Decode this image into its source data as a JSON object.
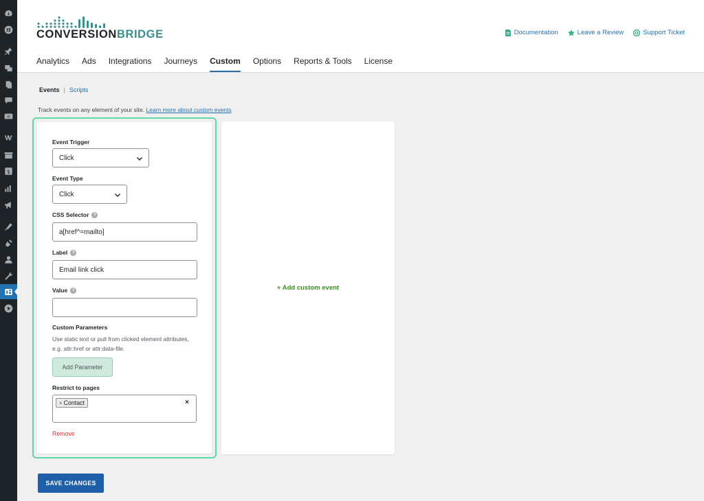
{
  "brand": {
    "logo_text_main": "CONVERSION",
    "logo_text_accent": "BRIDGE",
    "accent_color": "#3a8f8c",
    "bar_color": "#3a8f8c"
  },
  "top_links": [
    {
      "label": "Documentation",
      "icon": "document-icon"
    },
    {
      "label": "Leave a Review",
      "icon": "star-icon"
    },
    {
      "label": "Support Ticket",
      "icon": "lifebuoy-icon"
    }
  ],
  "tabs": [
    {
      "label": "Analytics",
      "active": false
    },
    {
      "label": "Ads",
      "active": false
    },
    {
      "label": "Integrations",
      "active": false
    },
    {
      "label": "Journeys",
      "active": false
    },
    {
      "label": "Custom",
      "active": true
    },
    {
      "label": "Options",
      "active": false
    },
    {
      "label": "Reports & Tools",
      "active": false
    },
    {
      "label": "License",
      "active": false
    }
  ],
  "subnav": {
    "active": "Events",
    "separator": "|",
    "link": "Scripts"
  },
  "intro": {
    "text": "Track events on any element of your site.",
    "link": "Learn more about custom events"
  },
  "event_form": {
    "event_trigger_label": "Event Trigger",
    "event_trigger_value": "Click",
    "event_type_label": "Event Type",
    "event_type_value": "Click",
    "css_selector_label": "CSS Selector",
    "css_selector_value": "a[href^=mailto]",
    "label_label": "Label",
    "label_value": "Email link click",
    "value_label": "Value",
    "value_value": "",
    "custom_params_label": "Custom Parameters",
    "custom_params_help": "Use static text or pull from clicked element attributes, e.g. attr:href or attr:data-file.",
    "add_parameter": "Add Parameter",
    "restrict_label": "Restrict to pages",
    "restrict_chip": "Contact",
    "chip_remove": "×",
    "clear_all": "×",
    "remove": "Remove"
  },
  "add_custom_event": "+ Add custom event",
  "save_button": "SAVE CHANGES",
  "colors": {
    "outline": "#5fd6a6",
    "primary": "#1f5ea8",
    "link": "#2271b1",
    "danger": "#d63638",
    "add_green": "#3c8f1f"
  },
  "sidebar_icons": [
    "dashboard-icon",
    "elementor-icon",
    "pin-icon",
    "media-icon",
    "pages-icon",
    "comments-icon",
    "woocommerce-icon",
    "w-icon",
    "archive-icon",
    "dollar-icon",
    "analytics-icon",
    "megaphone-icon",
    "appearance-icon",
    "plugins-icon",
    "users-icon",
    "tools-icon",
    "conversion-bridge-icon",
    "play-icon"
  ]
}
